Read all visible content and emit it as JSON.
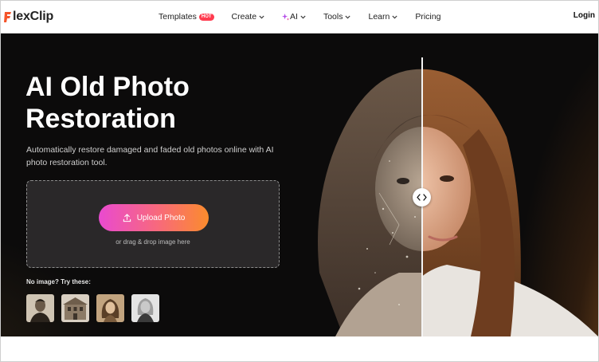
{
  "brand": {
    "logo_text": "lexClip",
    "accent": "#f5542a"
  },
  "nav": {
    "items": [
      {
        "label": "Templates",
        "badge": "HOT",
        "dropdown": false
      },
      {
        "label": "Create",
        "dropdown": true
      },
      {
        "label": "AI",
        "dropdown": true,
        "icon": "sparkle-icon"
      },
      {
        "label": "Tools",
        "dropdown": true
      },
      {
        "label": "Learn",
        "dropdown": true
      },
      {
        "label": "Pricing",
        "dropdown": false
      }
    ],
    "login_label": "Login"
  },
  "hero": {
    "title": "AI Old Photo Restoration",
    "subtitle": "Automatically restore damaged and faded old photos online with AI photo restoration tool.",
    "upload_label": "Upload Photo",
    "drop_hint": "or drag & drop image here",
    "samples_label": "No image? Try these:",
    "samples": [
      {
        "icon": "old-man-portrait"
      },
      {
        "icon": "old-building-photo"
      },
      {
        "icon": "vintage-woman-portrait"
      },
      {
        "icon": "elderly-woman-portrait"
      }
    ],
    "compare": {
      "icon": "compare-arrows-icon"
    }
  },
  "colors": {
    "hero_bg": "#0c0b0b",
    "upload_gradient": [
      "#e94ad0",
      "#f86a7a",
      "#fb8c2c"
    ],
    "hot_badge": "#ff3b4f"
  }
}
